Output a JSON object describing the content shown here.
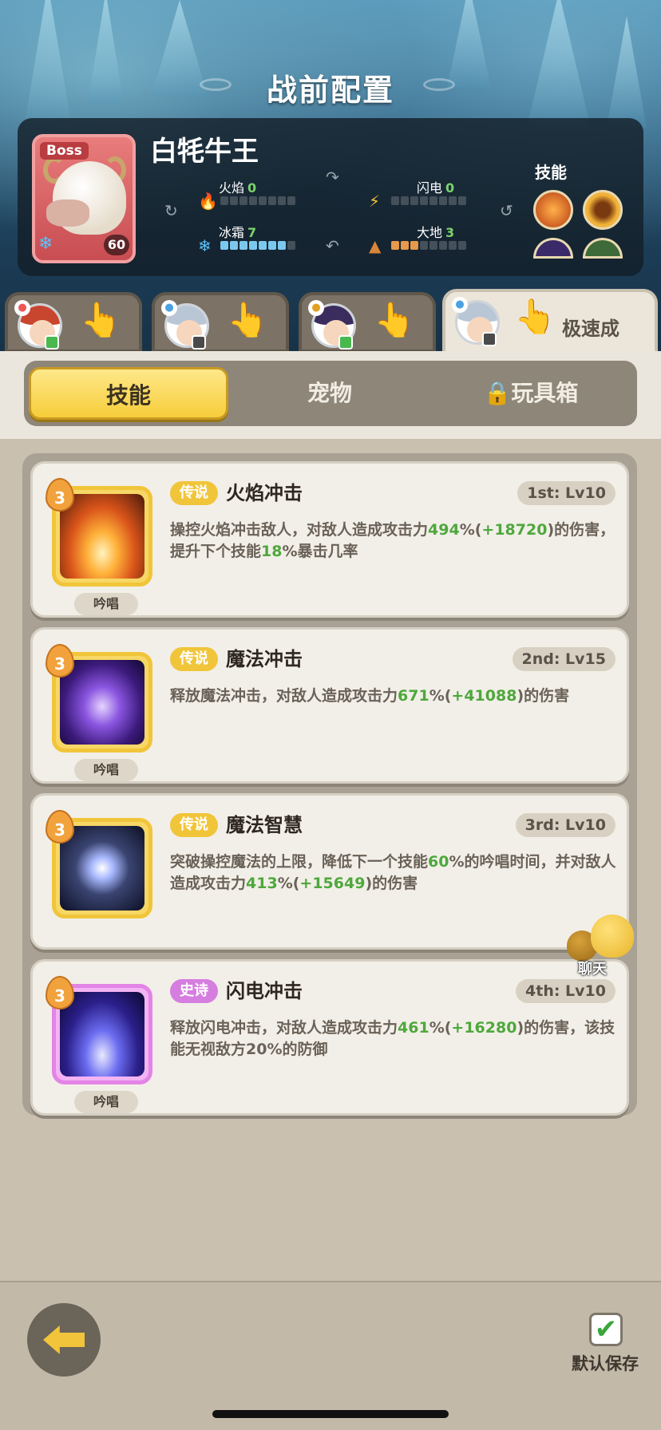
{
  "title": "战前配置",
  "boss": {
    "tag": "Boss",
    "name": "白牦牛王",
    "level": "60",
    "elements": {
      "fire": {
        "label": "火焰",
        "value": "0",
        "level": 0
      },
      "lightning": {
        "label": "闪电",
        "value": "0",
        "level": 0
      },
      "ice": {
        "label": "冰霜",
        "value": "7",
        "level": 7
      },
      "earth": {
        "label": "大地",
        "value": "3",
        "level": 3
      }
    },
    "skills_label": "技能"
  },
  "hero_tabs": {
    "quick_label": "极速成"
  },
  "segments": {
    "skills": "技能",
    "pets": "宠物",
    "toybox": "玩具箱"
  },
  "skills": [
    {
      "level": "3",
      "chant": "吟唱",
      "rarity": "传说",
      "name": "火焰冲击",
      "slot": "1st: Lv10",
      "desc_parts": [
        "操控火焰冲击敌人，对敌人造成攻击力",
        "494",
        "%(",
        "+18720",
        ")的伤害，提升下个技能",
        "18",
        "%暴击几率"
      ]
    },
    {
      "level": "3",
      "chant": "吟唱",
      "rarity": "传说",
      "name": "魔法冲击",
      "slot": "2nd: Lv15",
      "desc_parts": [
        "释放魔法冲击，对敌人造成攻击力",
        "671",
        "%(",
        "+41088",
        ")的伤害"
      ]
    },
    {
      "level": "3",
      "rarity": "传说",
      "name": "魔法智慧",
      "slot": "3rd: Lv10",
      "desc_parts": [
        "突破操控魔法的上限，降低下一个技能",
        "60",
        "%的吟唱时间，并对敌人造成攻击力",
        "413",
        "%(",
        "+15649",
        ")的伤害"
      ]
    },
    {
      "level": "3",
      "chant": "吟唱",
      "rarity": "史诗",
      "name": "闪电冲击",
      "slot": "4th: Lv10",
      "desc_parts": [
        "释放闪电冲击，对敌人造成攻击力",
        "461",
        "%(",
        "+16280",
        ")的伤害，该技能无视敌方20%的防御"
      ]
    }
  ],
  "chat_label": "聊天",
  "footer": {
    "save_label": "默认保存"
  },
  "colors": {
    "accent_yellow": "#f6cd3a",
    "highlight_green": "#4ea83c",
    "epic_purple": "#d57ee0"
  }
}
